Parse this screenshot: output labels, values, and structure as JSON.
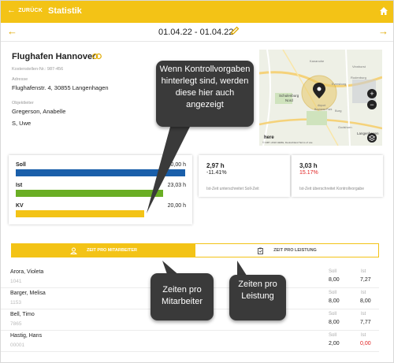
{
  "topbar": {
    "back_label": "ZURÜCK",
    "title": "Statistik"
  },
  "datebar": {
    "range": "01.04.22 - 01.04.22"
  },
  "location": {
    "name": "Flughafen Hannover",
    "cost_center_label": "Kostenstellen-Nr.: 987-456",
    "address_label": "Adresse",
    "address": "Flughafenstr. 4, 30855 Langenhagen",
    "manager_label": "Objektleiter",
    "manager_1": "Gregerson, Anabelle",
    "manager_2": "S, Uwe"
  },
  "map": {
    "labels": [
      "Kananohe",
      "Vinnhorst",
      "Eversborg",
      "Godshorn",
      "Schulenburg",
      "Nord",
      "Airport",
      "Business Park",
      "Burg",
      "Rodenburg",
      "Langenhagen"
    ],
    "copyright": "© 1987–2022 HERE, Deutschland  Terms of use",
    "brand": "here"
  },
  "bars": {
    "soll": {
      "label": "Soll",
      "value": "20,00 h",
      "fraction": 1.0,
      "color": "#1a5faa"
    },
    "ist": {
      "label": "Ist",
      "value": "23,03 h",
      "fraction": 0.87,
      "color": "#6aae24"
    },
    "kv": {
      "label": "KV",
      "value": "20,00 h",
      "fraction": 0.76,
      "color": "#f3c316"
    }
  },
  "stats": [
    {
      "value": "2,97 h",
      "pct": "-11.41%",
      "desc": "Ist-Zeit unterschreitet Soll-Zeit",
      "pct_color": "#222"
    },
    {
      "value": "3,03 h",
      "pct": "15.17%",
      "desc": "Ist-Zeit überschreitet Kontrollvorgabe",
      "pct_color": "#e02020"
    }
  ],
  "tabs": {
    "employee": "ZEIT PRO MITARBEITER",
    "service": "ZEIT PRO LEISTUNG"
  },
  "list": {
    "soll_header": "Soll",
    "ist_header": "Ist",
    "rows": [
      {
        "name": "Arora, Violeta",
        "id": "1041",
        "soll": "8,00",
        "ist": "7,27",
        "ist_color": "#222"
      },
      {
        "name": "Barger, Melisa",
        "id": "1153",
        "soll": "8,00",
        "ist": "8,00",
        "ist_color": "#222"
      },
      {
        "name": "Bell, Timo",
        "id": "7865",
        "soll": "8,00",
        "ist": "7,77",
        "ist_color": "#222"
      },
      {
        "name": "Hastig, Hans",
        "id": "00001",
        "soll": "2,00",
        "ist": "0,00",
        "ist_color": "#e02020"
      }
    ]
  },
  "callouts": {
    "kontroll": "Wenn Kontrollvorgaben hinterlegt sind, werden diese hier auch angezeigt",
    "mitarbeiter": "Zeiten pro Mitarbeiter",
    "leistung": "Zeiten pro Leistung"
  },
  "colors": {
    "accent": "#f3c316",
    "soll": "#1a5faa",
    "ist": "#6aae24",
    "negative": "#e02020",
    "callout": "#3a3a3a"
  }
}
